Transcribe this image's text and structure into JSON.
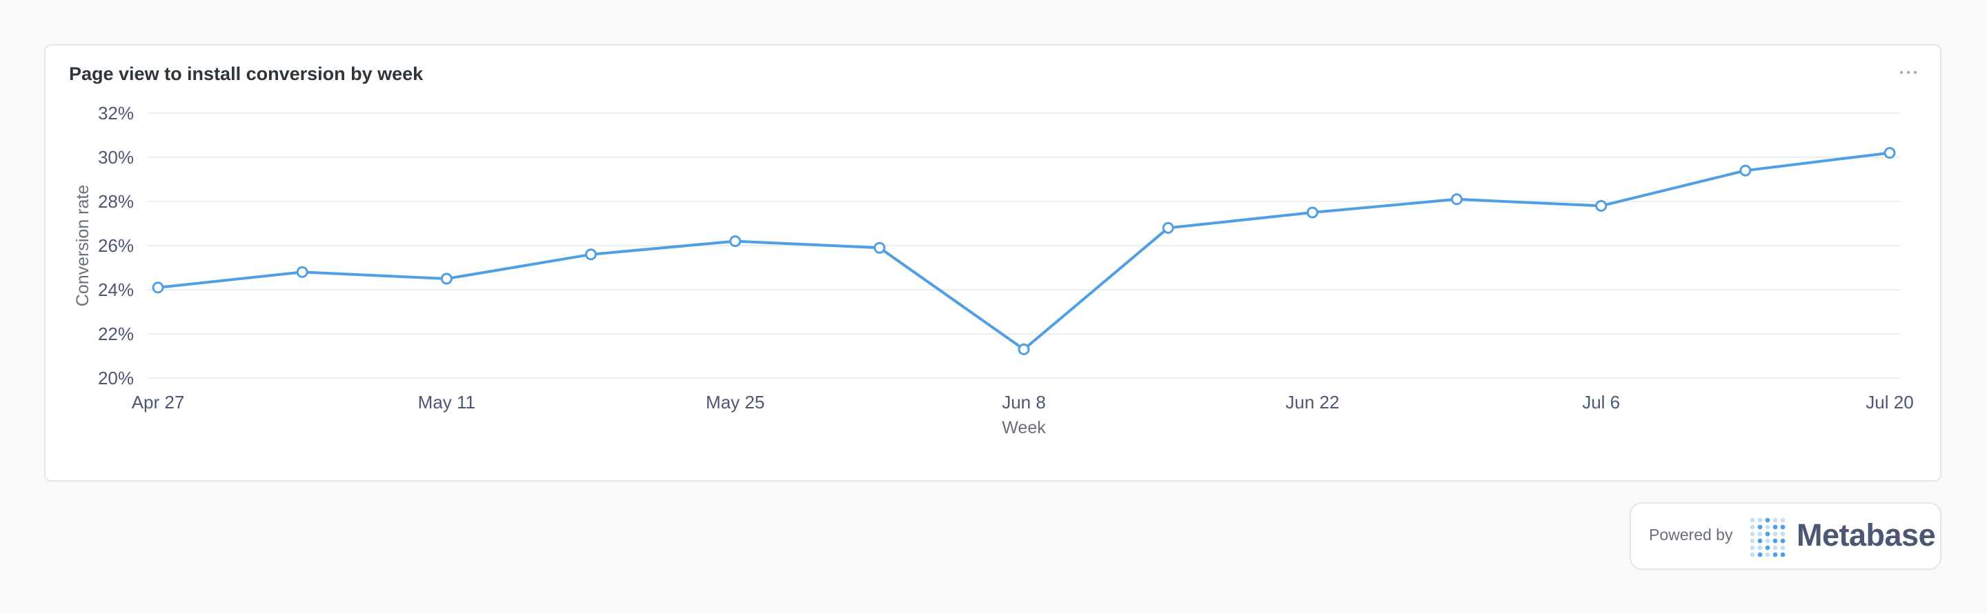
{
  "card": {
    "title": "Page view to install conversion by week",
    "more_icon": "ellipsis-icon"
  },
  "powered_by": {
    "label": "Powered by",
    "brand": "Metabase",
    "logo_icon": "metabase-logo-icon"
  },
  "colors": {
    "series": "#509ee3",
    "grid": "#ebedf0",
    "axis_text": "#4c5773",
    "title": "#2e353b"
  },
  "chart_data": {
    "type": "line",
    "xlabel": "Week",
    "ylabel": "Conversion rate",
    "x_tick_labels": [
      "Apr 27",
      "May 11",
      "May 25",
      "Jun 8",
      "Jun 22",
      "Jul 6",
      "Jul 20"
    ],
    "y_tick_labels": [
      "20%",
      "22%",
      "24%",
      "26%",
      "28%",
      "30%",
      "32%"
    ],
    "ylim": [
      20,
      32
    ],
    "y_unit": "%",
    "grid": true,
    "series": [
      {
        "x": [
          "Apr 27",
          "May 4",
          "May 11",
          "May 18",
          "May 25",
          "Jun 1",
          "Jun 8",
          "Jun 15",
          "Jun 22",
          "Jun 29",
          "Jul 6",
          "Jul 13",
          "Jul 20"
        ],
        "values": [
          24.1,
          24.8,
          24.5,
          25.6,
          26.2,
          25.9,
          21.3,
          26.8,
          27.5,
          28.1,
          27.8,
          29.4,
          30.2
        ]
      }
    ]
  }
}
